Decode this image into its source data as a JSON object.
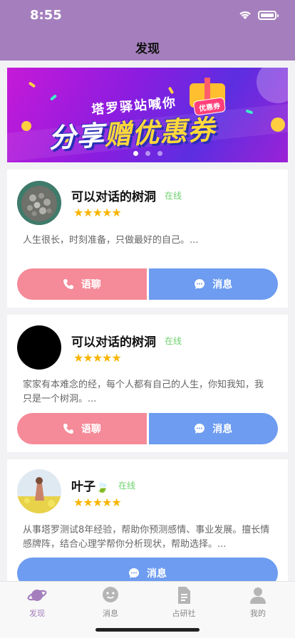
{
  "status": {
    "time": "8:55"
  },
  "header": {
    "title": "发现"
  },
  "banner": {
    "subtitle": "塔罗驿站喊你",
    "headline_a": "分享",
    "headline_b": "赠优惠券",
    "tag": "优惠券",
    "page_count": 3,
    "active_page": 1
  },
  "cards": [
    {
      "name": "可以对话的树洞",
      "status": "在线",
      "rating": 5,
      "stars": "★★★★★",
      "description": "人生很长，时刻准备，只做最好的自己。...",
      "call_label": "语聊",
      "message_label": "消息"
    },
    {
      "name": "可以对话的树洞",
      "status": "在线",
      "rating": 5,
      "stars": "★★★★★",
      "description": "家家有本难念的经，每个人都有自己的人生，你知我知，我只是一个树洞。...",
      "call_label": "语聊",
      "message_label": "消息"
    },
    {
      "name": "叶子",
      "name_emoji": "🍃",
      "status": "在线",
      "rating": 5,
      "stars": "★★★★★",
      "description": "从事塔罗测试8年经验，帮助你预测感情、事业发展。擅长情感牌阵，结合心理学帮你分析现状，帮助选择。...",
      "message_label": "消息"
    }
  ],
  "tabbar": {
    "tabs": [
      {
        "label": "发现",
        "icon": "planet-icon",
        "active": true
      },
      {
        "label": "消息",
        "icon": "chat-bubble-icon",
        "active": false
      },
      {
        "label": "占研社",
        "icon": "document-icon",
        "active": false
      },
      {
        "label": "我的",
        "icon": "person-icon",
        "active": false
      }
    ]
  },
  "colors": {
    "header": "#a57fbd",
    "call_button": "#f58a98",
    "message_button": "#6d9cf0",
    "star": "#f7b500",
    "online": "#6cd26c",
    "tab_active": "#a57fbd"
  }
}
